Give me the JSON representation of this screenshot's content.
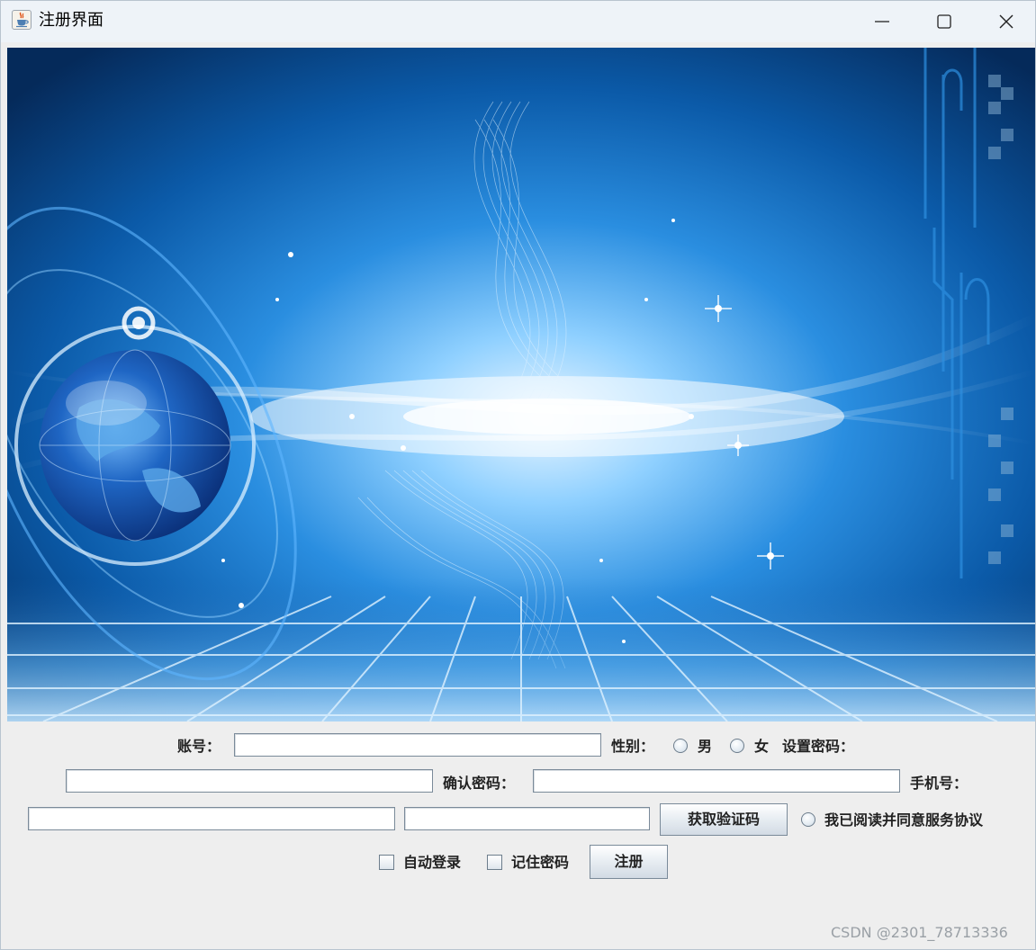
{
  "window": {
    "title": "注册界面",
    "icon": "java-cup-icon",
    "controls": [
      "minimize-icon",
      "maximize-icon",
      "close-icon"
    ]
  },
  "banner": {
    "image": "blue-technology-globe-background"
  },
  "form": {
    "account_label": "账号：",
    "account_value": "",
    "gender_label": "性别：",
    "gender_options": [
      "男",
      "女"
    ],
    "set_password_label": "设置密码：",
    "password_value": "",
    "confirm_password_label": "确认密码：",
    "confirm_password_value": "",
    "phone_label": "手机号：",
    "phone_value": "",
    "verify_code_value": "",
    "get_code_button": "获取验证码",
    "agree_label": "我已阅读并同意服务协议",
    "auto_login_label": "自动登录",
    "remember_password_label": "记住密码",
    "register_button": "注册"
  },
  "watermark": "CSDN @2301_78713336",
  "colors": {
    "titlebar_bg": "#eef3f8",
    "window_bg": "#eeeeee",
    "banner_blue": "#0c4f95"
  }
}
